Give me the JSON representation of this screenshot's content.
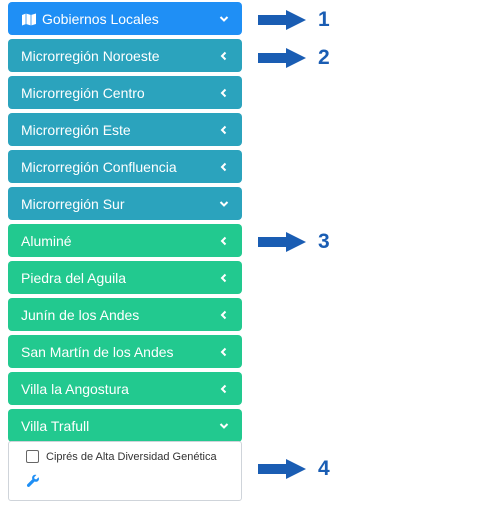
{
  "menu": {
    "header": {
      "label": "Gobiernos Locales",
      "icon": "map-icon",
      "chevron": "chevron-down-icon",
      "color": "#1f8ff5"
    },
    "regions": [
      {
        "label": "Microrregión Noroeste",
        "chevron": "chevron-left-icon"
      },
      {
        "label": "Microrregión Centro",
        "chevron": "chevron-left-icon"
      },
      {
        "label": "Microrregión Este",
        "chevron": "chevron-left-icon"
      },
      {
        "label": "Microrregión Confluencia",
        "chevron": "chevron-left-icon"
      },
      {
        "label": "Microrregión Sur",
        "chevron": "chevron-down-icon"
      }
    ],
    "localities": [
      {
        "label": "Aluminé",
        "chevron": "chevron-left-icon"
      },
      {
        "label": "Piedra del Aguila",
        "chevron": "chevron-left-icon"
      },
      {
        "label": "Junín de los Andes",
        "chevron": "chevron-left-icon"
      },
      {
        "label": "San Martín de los Andes",
        "chevron": "chevron-left-icon"
      },
      {
        "label": "Villa la Angostura",
        "chevron": "chevron-left-icon"
      },
      {
        "label": "Villa Trafull",
        "chevron": "chevron-down-icon"
      }
    ],
    "layer": {
      "label": "Ciprés de Alta Diversidad Genética",
      "checked": false,
      "tool_icon": "wrench-icon"
    }
  },
  "callouts": [
    "1",
    "2",
    "3",
    "4"
  ],
  "colors": {
    "header": "#1f8ff5",
    "region": "#2ba3bd",
    "locality": "#22c98f",
    "callout": "#1a5db3"
  }
}
